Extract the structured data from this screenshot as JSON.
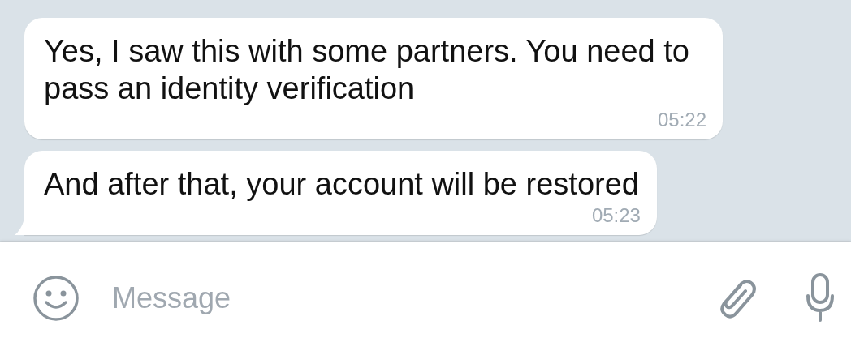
{
  "messages": [
    {
      "text": "Yes, I saw this with some partners. You need to pass an identity verification",
      "time": "05:22",
      "tail": false
    },
    {
      "text": "And after that, your account will be restored",
      "time": "05:23",
      "tail": true
    }
  ],
  "composer": {
    "placeholder": "Message"
  }
}
